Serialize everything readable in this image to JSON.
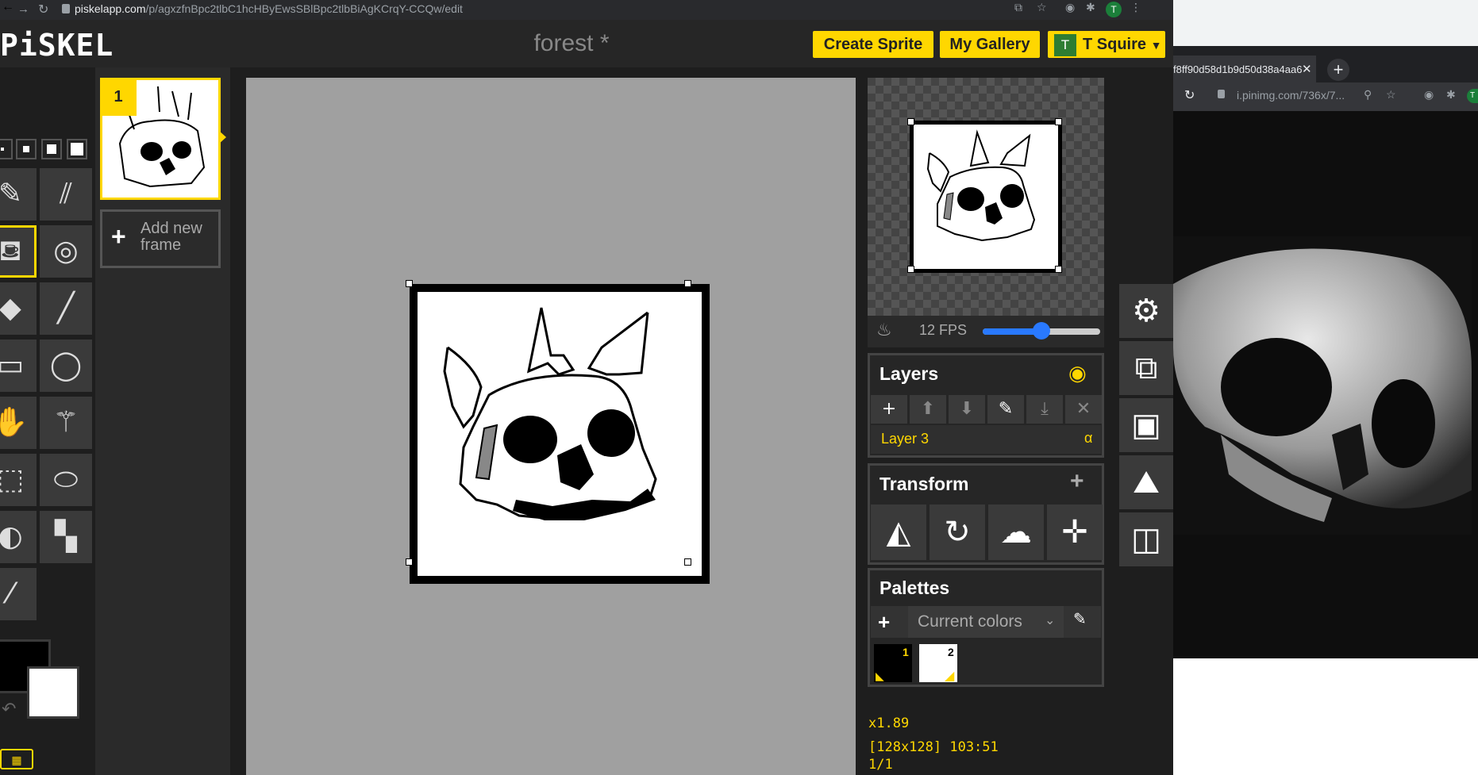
{
  "browser": {
    "url_host": "piskelapp.com",
    "url_path": "/p/agxzfnBpc2tlbC1hcHByEwsSBlBpc2tlbBiAgKCrqY-CCQw/edit",
    "profile_initial": "T"
  },
  "header": {
    "logo": "PiSKEL",
    "title": "forest *",
    "create_sprite": "Create Sprite",
    "my_gallery": "My Gallery",
    "user_initial": "T",
    "user_name": "T Squire"
  },
  "tools": {
    "pen_sizes": [
      1,
      2,
      3,
      4
    ],
    "items": [
      "pen-tool",
      "vertical-mirror-pen",
      "paint-bucket",
      "spray-bucket",
      "eraser",
      "stroke",
      "rectangle",
      "ellipse",
      "move",
      "shape-selection",
      "rectangle-selection",
      "lasso-selection",
      "lighten",
      "dithering",
      "color-picker"
    ]
  },
  "colors": {
    "primary": "#000000",
    "secondary": "#ffffff",
    "accent": "#ffd700"
  },
  "frames": {
    "items": [
      {
        "number": "1"
      }
    ],
    "add_label_line1": "Add new",
    "add_label_line2": "frame"
  },
  "preview": {
    "fps_label": "12 FPS",
    "fps_fraction": 0.5
  },
  "layers": {
    "title": "Layers",
    "buttons": [
      "add-layer",
      "move-layer-up",
      "move-layer-down",
      "rename-layer",
      "merge-layer",
      "delete-layer"
    ],
    "current": "Layer 3",
    "alpha_symbol": "α"
  },
  "transform": {
    "title": "Transform",
    "add_symbol": "+",
    "buttons": [
      "flip",
      "rotate",
      "clone",
      "center"
    ]
  },
  "palettes": {
    "title": "Palettes",
    "selected": "Current colors",
    "swatches": [
      {
        "index": "1",
        "color": "#000000"
      },
      {
        "index": "2",
        "color": "#ffffff"
      }
    ]
  },
  "status": {
    "zoom": "x1.89",
    "size_and_cursor": "[128x128] 103:51",
    "frame_counter": "1/1"
  },
  "side_window": {
    "tab_title": "f8ff90d58d1b9d50d38a4aa6",
    "url": "i.pinimg.com/736x/7...",
    "profile_initial": "T"
  }
}
